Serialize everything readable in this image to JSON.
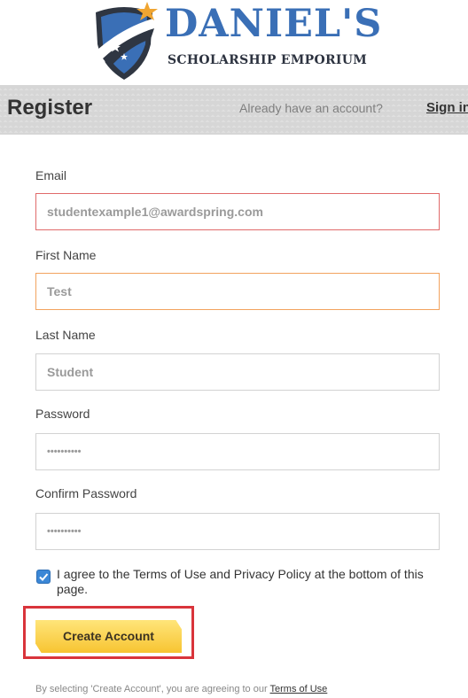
{
  "header": {
    "logo_title": "DANIEL'S",
    "logo_subtitle": "SCHOLARSHIP EMPORIUM"
  },
  "register_bar": {
    "title": "Register",
    "have_account_text": "Already have an account?",
    "sign_in_label": "Sign in"
  },
  "form": {
    "email": {
      "label": "Email",
      "value": "studentexample1@awardspring.com"
    },
    "first_name": {
      "label": "First Name",
      "value": "Test"
    },
    "last_name": {
      "label": "Last Name",
      "value": "Student"
    },
    "password": {
      "label": "Password",
      "value": "••••••••••"
    },
    "confirm_password": {
      "label": "Confirm Password",
      "value": "••••••••••"
    },
    "agree_checked": true,
    "agree_text": "I agree to the Terms of Use and Privacy Policy at the bottom of this page.",
    "create_button_label": "Create Account"
  },
  "footer": {
    "note_prefix": "By selecting 'Create Account', you are agreeing to our ",
    "terms_link": "Terms of Use"
  },
  "colors": {
    "brand_blue": "#3a6fb6",
    "button_yellow": "#f7c431",
    "highlight_red": "#d9343b",
    "error_border": "#e06a6a",
    "focus_border": "#f2a35e"
  },
  "icons": {
    "logo": "shield-star-logo-icon",
    "checkbox": "check-icon"
  }
}
